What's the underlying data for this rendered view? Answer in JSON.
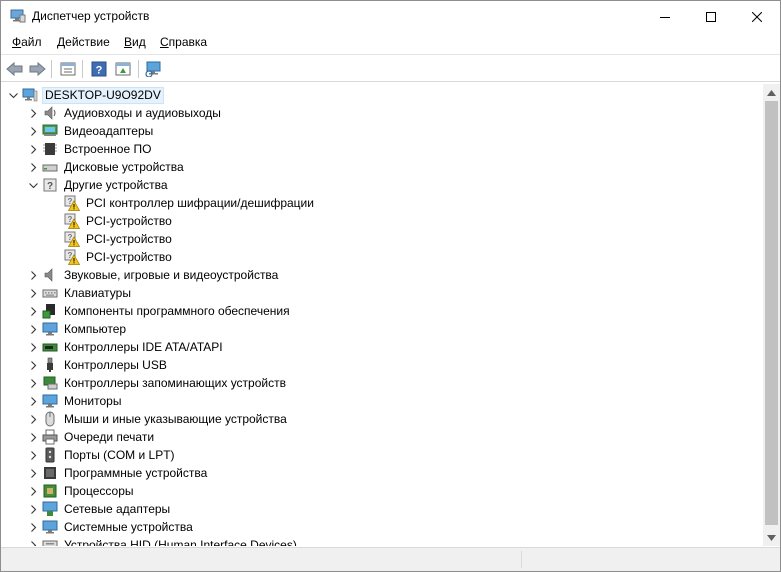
{
  "window": {
    "title": "Диспетчер устройств"
  },
  "menu": [
    {
      "label": "Файл",
      "hotkey": "Ф",
      "rest": "айл"
    },
    {
      "label": "Действие",
      "hotkey": "Д",
      "rest": "ействие"
    },
    {
      "label": "Вид",
      "hotkey": "В",
      "rest": "ид"
    },
    {
      "label": "Справка",
      "hotkey": "С",
      "rest": "правка"
    }
  ],
  "toolbar": {
    "buttons": [
      "back-icon",
      "forward-icon",
      "properties-icon",
      "help-icon",
      "update-driver-icon",
      "scan-hardware-icon"
    ]
  },
  "tree": {
    "root": "DESKTOP-U9O92DV",
    "categories": [
      {
        "label": "Аудиовходы и аудиовыходы",
        "icon": "audio-io-icon",
        "expanded": false
      },
      {
        "label": "Видеоадаптеры",
        "icon": "display-adapter-icon",
        "expanded": false
      },
      {
        "label": "Встроенное ПО",
        "icon": "firmware-icon",
        "expanded": false
      },
      {
        "label": "Дисковые устройства",
        "icon": "disk-drive-icon",
        "expanded": false
      },
      {
        "label": "Другие устройства",
        "icon": "other-devices-icon",
        "expanded": true,
        "children": [
          {
            "label": "PCI контроллер шифрации/дешифрации",
            "icon": "warning-device-icon"
          },
          {
            "label": "PCI-устройство",
            "icon": "warning-device-icon"
          },
          {
            "label": "PCI-устройство",
            "icon": "warning-device-icon"
          },
          {
            "label": "PCI-устройство",
            "icon": "warning-device-icon"
          }
        ]
      },
      {
        "label": "Звуковые, игровые и видеоустройства",
        "icon": "sound-icon",
        "expanded": false
      },
      {
        "label": "Клавиатуры",
        "icon": "keyboard-icon",
        "expanded": false
      },
      {
        "label": "Компоненты программного обеспечения",
        "icon": "software-component-icon",
        "expanded": false
      },
      {
        "label": "Компьютер",
        "icon": "computer-icon",
        "expanded": false
      },
      {
        "label": "Контроллеры IDE ATA/ATAPI",
        "icon": "ide-controller-icon",
        "expanded": false
      },
      {
        "label": "Контроллеры USB",
        "icon": "usb-icon",
        "expanded": false
      },
      {
        "label": "Контроллеры запоминающих устройств",
        "icon": "storage-controller-icon",
        "expanded": false
      },
      {
        "label": "Мониторы",
        "icon": "monitor-icon",
        "expanded": false
      },
      {
        "label": "Мыши и иные указывающие устройства",
        "icon": "mouse-icon",
        "expanded": false
      },
      {
        "label": "Очереди печати",
        "icon": "printer-icon",
        "expanded": false
      },
      {
        "label": "Порты (COM и LPT)",
        "icon": "port-icon",
        "expanded": false
      },
      {
        "label": "Программные устройства",
        "icon": "software-device-icon",
        "expanded": false
      },
      {
        "label": "Процессоры",
        "icon": "processor-icon",
        "expanded": false
      },
      {
        "label": "Сетевые адаптеры",
        "icon": "network-adapter-icon",
        "expanded": false
      },
      {
        "label": "Системные устройства",
        "icon": "system-device-icon",
        "expanded": false
      },
      {
        "label": "Устройства HID (Human Interface Devices)",
        "icon": "hid-icon",
        "expanded": false
      }
    ]
  },
  "colors": {
    "selection_bg": "#e5f1fb",
    "selection_border": "#cce4f7",
    "warning": "#f5c518",
    "scroll_thumb": "#c1c1c1"
  }
}
